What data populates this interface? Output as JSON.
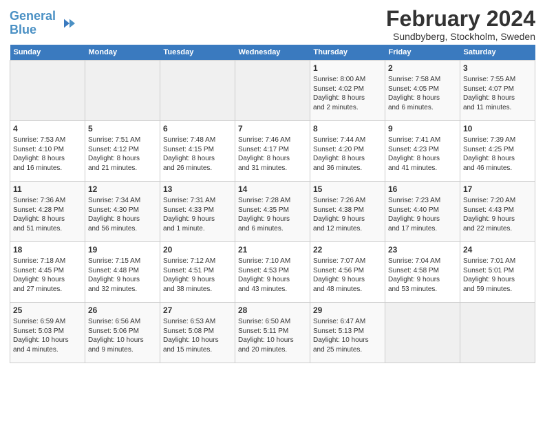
{
  "logo": {
    "text_general": "General",
    "text_blue": "Blue"
  },
  "title": "February 2024",
  "subtitle": "Sundbyberg, Stockholm, Sweden",
  "headers": [
    "Sunday",
    "Monday",
    "Tuesday",
    "Wednesday",
    "Thursday",
    "Friday",
    "Saturday"
  ],
  "weeks": [
    [
      {
        "day": "",
        "content": ""
      },
      {
        "day": "",
        "content": ""
      },
      {
        "day": "",
        "content": ""
      },
      {
        "day": "",
        "content": ""
      },
      {
        "day": "1",
        "content": "Sunrise: 8:00 AM\nSunset: 4:02 PM\nDaylight: 8 hours\nand 2 minutes."
      },
      {
        "day": "2",
        "content": "Sunrise: 7:58 AM\nSunset: 4:05 PM\nDaylight: 8 hours\nand 6 minutes."
      },
      {
        "day": "3",
        "content": "Sunrise: 7:55 AM\nSunset: 4:07 PM\nDaylight: 8 hours\nand 11 minutes."
      }
    ],
    [
      {
        "day": "4",
        "content": "Sunrise: 7:53 AM\nSunset: 4:10 PM\nDaylight: 8 hours\nand 16 minutes."
      },
      {
        "day": "5",
        "content": "Sunrise: 7:51 AM\nSunset: 4:12 PM\nDaylight: 8 hours\nand 21 minutes."
      },
      {
        "day": "6",
        "content": "Sunrise: 7:48 AM\nSunset: 4:15 PM\nDaylight: 8 hours\nand 26 minutes."
      },
      {
        "day": "7",
        "content": "Sunrise: 7:46 AM\nSunset: 4:17 PM\nDaylight: 8 hours\nand 31 minutes."
      },
      {
        "day": "8",
        "content": "Sunrise: 7:44 AM\nSunset: 4:20 PM\nDaylight: 8 hours\nand 36 minutes."
      },
      {
        "day": "9",
        "content": "Sunrise: 7:41 AM\nSunset: 4:23 PM\nDaylight: 8 hours\nand 41 minutes."
      },
      {
        "day": "10",
        "content": "Sunrise: 7:39 AM\nSunset: 4:25 PM\nDaylight: 8 hours\nand 46 minutes."
      }
    ],
    [
      {
        "day": "11",
        "content": "Sunrise: 7:36 AM\nSunset: 4:28 PM\nDaylight: 8 hours\nand 51 minutes."
      },
      {
        "day": "12",
        "content": "Sunrise: 7:34 AM\nSunset: 4:30 PM\nDaylight: 8 hours\nand 56 minutes."
      },
      {
        "day": "13",
        "content": "Sunrise: 7:31 AM\nSunset: 4:33 PM\nDaylight: 9 hours\nand 1 minute."
      },
      {
        "day": "14",
        "content": "Sunrise: 7:28 AM\nSunset: 4:35 PM\nDaylight: 9 hours\nand 6 minutes."
      },
      {
        "day": "15",
        "content": "Sunrise: 7:26 AM\nSunset: 4:38 PM\nDaylight: 9 hours\nand 12 minutes."
      },
      {
        "day": "16",
        "content": "Sunrise: 7:23 AM\nSunset: 4:40 PM\nDaylight: 9 hours\nand 17 minutes."
      },
      {
        "day": "17",
        "content": "Sunrise: 7:20 AM\nSunset: 4:43 PM\nDaylight: 9 hours\nand 22 minutes."
      }
    ],
    [
      {
        "day": "18",
        "content": "Sunrise: 7:18 AM\nSunset: 4:45 PM\nDaylight: 9 hours\nand 27 minutes."
      },
      {
        "day": "19",
        "content": "Sunrise: 7:15 AM\nSunset: 4:48 PM\nDaylight: 9 hours\nand 32 minutes."
      },
      {
        "day": "20",
        "content": "Sunrise: 7:12 AM\nSunset: 4:51 PM\nDaylight: 9 hours\nand 38 minutes."
      },
      {
        "day": "21",
        "content": "Sunrise: 7:10 AM\nSunset: 4:53 PM\nDaylight: 9 hours\nand 43 minutes."
      },
      {
        "day": "22",
        "content": "Sunrise: 7:07 AM\nSunset: 4:56 PM\nDaylight: 9 hours\nand 48 minutes."
      },
      {
        "day": "23",
        "content": "Sunrise: 7:04 AM\nSunset: 4:58 PM\nDaylight: 9 hours\nand 53 minutes."
      },
      {
        "day": "24",
        "content": "Sunrise: 7:01 AM\nSunset: 5:01 PM\nDaylight: 9 hours\nand 59 minutes."
      }
    ],
    [
      {
        "day": "25",
        "content": "Sunrise: 6:59 AM\nSunset: 5:03 PM\nDaylight: 10 hours\nand 4 minutes."
      },
      {
        "day": "26",
        "content": "Sunrise: 6:56 AM\nSunset: 5:06 PM\nDaylight: 10 hours\nand 9 minutes."
      },
      {
        "day": "27",
        "content": "Sunrise: 6:53 AM\nSunset: 5:08 PM\nDaylight: 10 hours\nand 15 minutes."
      },
      {
        "day": "28",
        "content": "Sunrise: 6:50 AM\nSunset: 5:11 PM\nDaylight: 10 hours\nand 20 minutes."
      },
      {
        "day": "29",
        "content": "Sunrise: 6:47 AM\nSunset: 5:13 PM\nDaylight: 10 hours\nand 25 minutes."
      },
      {
        "day": "",
        "content": ""
      },
      {
        "day": "",
        "content": ""
      }
    ]
  ]
}
